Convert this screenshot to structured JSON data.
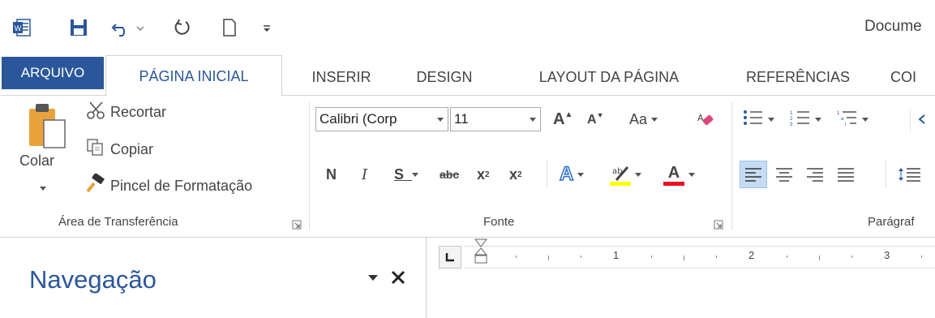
{
  "title_bar": {
    "document_title": "Docume"
  },
  "qat": {
    "icons": [
      "word-logo-icon",
      "save-icon",
      "undo-icon",
      "redo-icon",
      "new-document-icon",
      "customize-qat-icon"
    ],
    "colors": {
      "word_blue": "#2b579a"
    }
  },
  "tabs": {
    "file": "ARQUIVO",
    "home": "PÁGINA INICIAL",
    "insert": "INSERIR",
    "design": "DESIGN",
    "layout": "LAYOUT DA PÁGINA",
    "references": "REFERÊNCIAS",
    "mailings": "COI"
  },
  "clipboard": {
    "paste": "Colar",
    "cut": "Recortar",
    "copy": "Copiar",
    "format_painter": "Pincel de Formatação",
    "label": "Área de Transferência"
  },
  "font": {
    "font_name": "Calibri (Corp",
    "font_size": "11",
    "grow": "A",
    "shrink": "A",
    "change_case": "Aa",
    "bold": "N",
    "italic": "I",
    "underline": "S",
    "strikethrough": "abc",
    "subscript": "x",
    "superscript": "x",
    "font_color": "A",
    "text_effects": "A",
    "label": "Fonte"
  },
  "paragraph": {
    "label": "Parágraf"
  },
  "navigation": {
    "title": "Navegação"
  },
  "ruler": {
    "numbers": [
      "1",
      "2",
      "3"
    ]
  }
}
